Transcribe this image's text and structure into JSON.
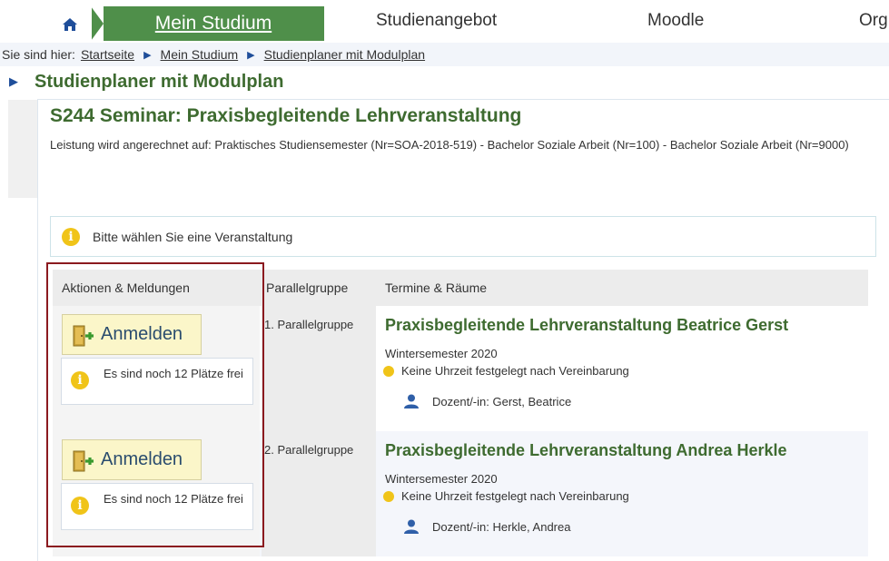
{
  "nav": {
    "home_icon": "home-icon",
    "active": "Mein Studium",
    "items": [
      "Studienangebot",
      "Moodle",
      "Org"
    ]
  },
  "breadcrumb": {
    "prefix": "Sie sind hier:",
    "items": [
      "Startseite",
      "Mein Studium",
      "Studienplaner mit Modulplan"
    ]
  },
  "page": {
    "title": "Studienplaner mit Modulplan",
    "module_title": "S244 Seminar: Praxisbegleitende Lehrveranstaltung",
    "credit_text": "Leistung wird angerechnet auf: Praktisches Studiensemester (Nr=SOA-2018-519) - Bachelor Soziale Arbeit (Nr=100) - Bachelor Soziale Arbeit (Nr=9000)",
    "info_message": "Bitte wählen Sie eine Veranstaltung"
  },
  "table": {
    "headers": [
      "Aktionen & Meldungen",
      "Parallelgruppe",
      "Termine & Räume"
    ],
    "rows": [
      {
        "button_label": "Anmelden",
        "slots_text": "Es sind noch 12 Plätze frei",
        "group": "1. Parallelgruppe",
        "event_title": "Praxisbegleitende Lehrveranstaltung Beatrice Gerst",
        "semester": "Wintersemester 2020",
        "time": "Keine Uhrzeit festgelegt nach Vereinbarung",
        "lecturer": "Dozent/-in: Gerst, Beatrice"
      },
      {
        "button_label": "Anmelden",
        "slots_text": "Es sind noch 12 Plätze frei",
        "group": "2. Parallelgruppe",
        "event_title": "Praxisbegleitende Lehrveranstaltung Andrea Herkle",
        "semester": "Wintersemester 2020",
        "time": "Keine Uhrzeit festgelegt nach Vereinbarung",
        "lecturer": "Dozent/-in: Herkle, Andrea"
      }
    ]
  },
  "colors": {
    "brand_green": "#4f8f4a",
    "title_green": "#3e6b30",
    "accent_blue": "#1f4e9a",
    "highlight_red": "#8b1a1f",
    "warning_yellow": "#f0c419"
  }
}
